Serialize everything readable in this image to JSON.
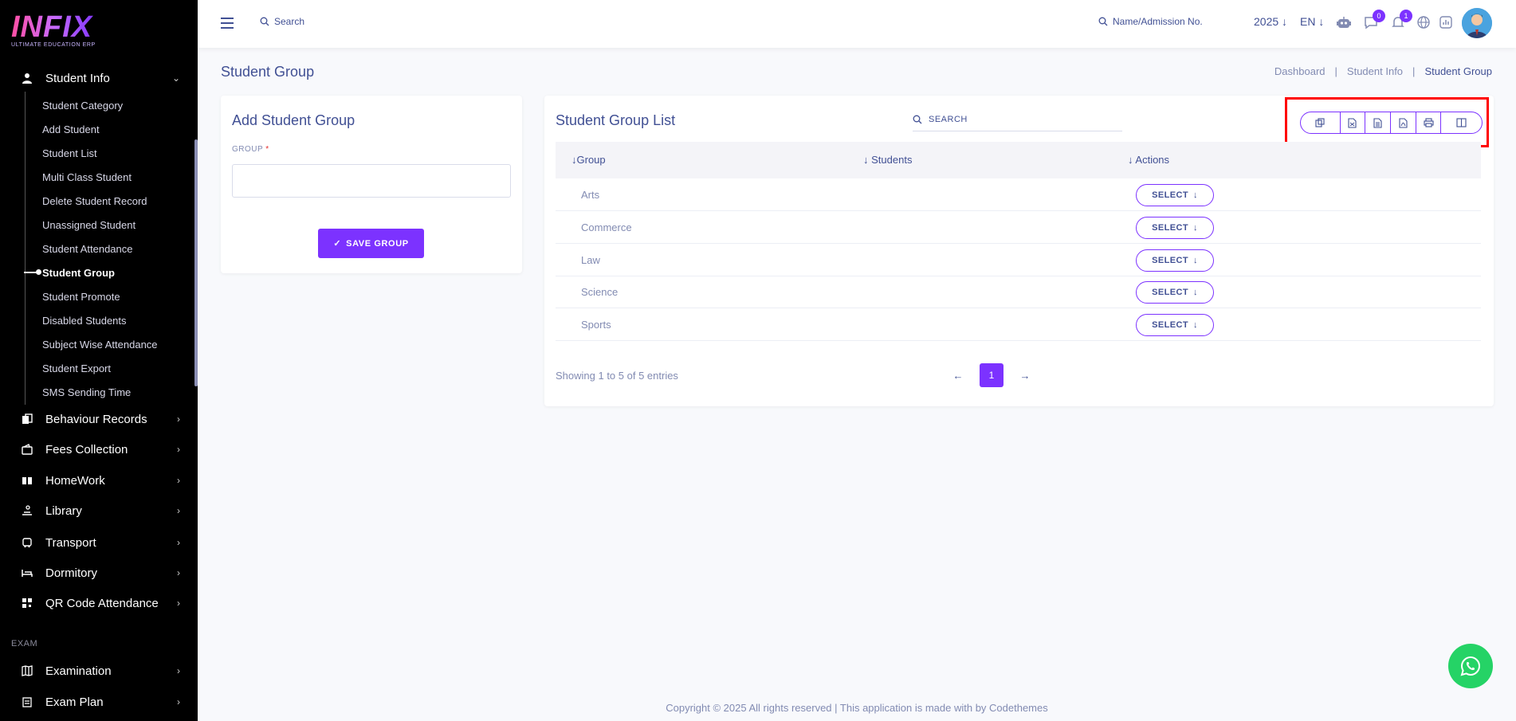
{
  "brand": {
    "logo_text": "INFIX",
    "logo_sub": "ULTIMATE EDUCATION ERP"
  },
  "sidebar": {
    "student_info": "Student Info",
    "sub_items": [
      "Student Category",
      "Add Student",
      "Student List",
      "Multi Class Student",
      "Delete Student Record",
      "Unassigned Student",
      "Student Attendance",
      "Student Group",
      "Student Promote",
      "Disabled Students",
      "Subject Wise Attendance",
      "Student Export",
      "SMS Sending Time"
    ],
    "active_index": 7,
    "modules": [
      "Behaviour Records",
      "Fees Collection",
      "HomeWork",
      "Library",
      "Transport",
      "Dormitory",
      "QR Code Attendance"
    ],
    "section_exam": "EXAM",
    "exam_modules": [
      "Examination",
      "Exam Plan"
    ]
  },
  "topbar": {
    "search_label": "Search",
    "name_search_label": "Name/Admission No.",
    "year": "2025",
    "lang": "EN",
    "chat_badge": "0",
    "notif_badge": "1"
  },
  "page": {
    "title": "Student Group",
    "breadcrumb": [
      "Dashboard",
      "Student Info",
      "Student Group"
    ]
  },
  "add_form": {
    "title": "Add Student Group",
    "group_label": "GROUP",
    "required_mark": "*",
    "group_value": "",
    "save_label": "SAVE GROUP"
  },
  "list": {
    "title": "Student Group List",
    "search_label": "SEARCH",
    "columns": [
      "Group",
      "Students",
      "Actions"
    ],
    "rows": [
      {
        "group": "Arts",
        "students": "",
        "action": "SELECT"
      },
      {
        "group": "Commerce",
        "students": "",
        "action": "SELECT"
      },
      {
        "group": "Law",
        "students": "",
        "action": "SELECT"
      },
      {
        "group": "Science",
        "students": "",
        "action": "SELECT"
      },
      {
        "group": "Sports",
        "students": "",
        "action": "SELECT"
      }
    ],
    "export_buttons": [
      "copy-icon",
      "csv-icon",
      "excel-icon",
      "pdf-icon",
      "print-icon",
      "columns-icon"
    ],
    "showing": "Showing 1 to 5 of 5 entries",
    "current_page": "1"
  },
  "footer": {
    "text": "Copyright © 2025 All rights reserved | This application is made with by Codethemes"
  },
  "colors": {
    "accent": "#7c32ff",
    "text": "#415094",
    "muted": "#828bb2",
    "highlight": "#ff0000",
    "whatsapp": "#25d366"
  }
}
